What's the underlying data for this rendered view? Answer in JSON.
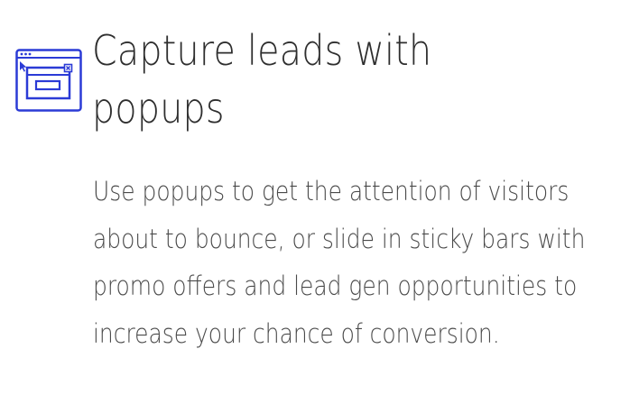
{
  "feature": {
    "icon": "popup-window-icon",
    "accent_color": "#2b3bd6",
    "title": "Capture leads with popups",
    "description": "Use popups to get the attention of visitors about to bounce, or slide in sticky bars with promo offers and lead gen opportunities to increase your chance of conversion."
  }
}
